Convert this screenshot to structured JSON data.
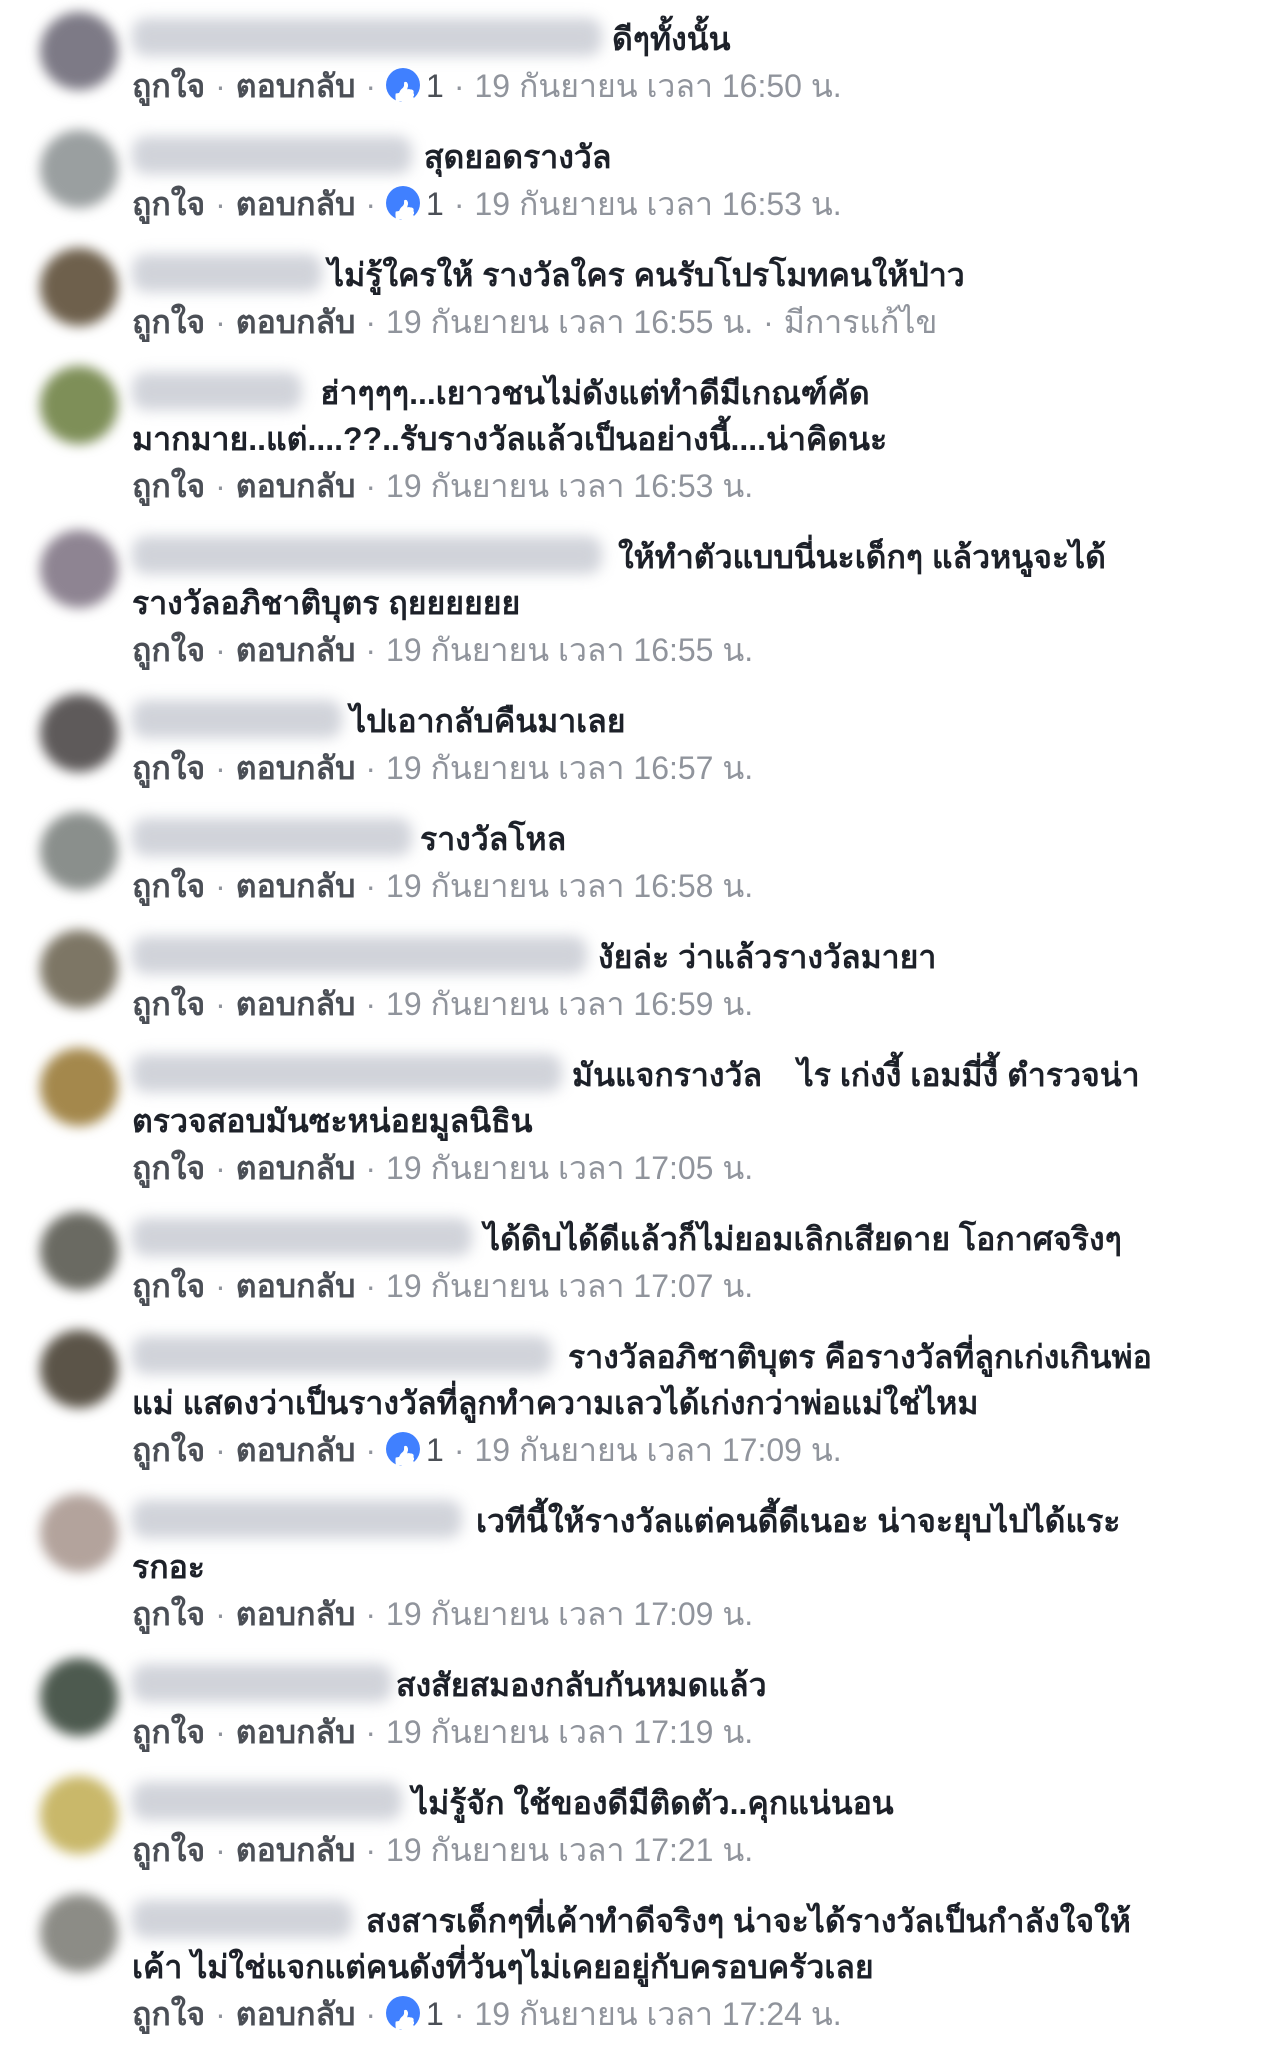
{
  "actions": {
    "like_label": "ถูกใจ",
    "reply_label": "ตอบกลับ",
    "separator": "·",
    "edited_label": "มีการแก้ไข"
  },
  "comments": [
    {
      "text": "ดีๆทั้งนั้น",
      "likes": "1",
      "time": "19 กันยายน เวลา 16:50 น."
    },
    {
      "text": "สุดยอดรางวัล",
      "likes": "1",
      "time": "19 กันยายน เวลา 16:53 น."
    },
    {
      "text": "ไม่รู้ใครให้ รางวัลใคร คนรับโปรโมทคนให้ป่าว",
      "time": "19 กันยายน เวลา 16:55 น."
    },
    {
      "text": "ฮ่าๆๆๆ...เยาวชนไม่ดังแต่ทำดีมีเกณฑ์คัด\nมากมาย..แต่....??..รับรางวัลแล้วเป็นอย่างนี้....น่าคิดนะ",
      "time": "19 กันยายน เวลา 16:53 น."
    },
    {
      "text": "ให้ทำตัวแบบนี่นะเด็กๆ แล้วหนูจะได้\nรางวัลอภิชาติบุตร ฤยยยยยย",
      "time": "19 กันยายน เวลา 16:55 น."
    },
    {
      "text": "ไปเอากลับคืนมาเลย",
      "time": "19 กันยายน เวลา 16:57 น."
    },
    {
      "text": "รางวัลโหล",
      "time": "19 กันยายน เวลา 16:58 น."
    },
    {
      "text": "งัยล่ะ ว่าแล้วรางวัลมายา",
      "time": "19 กันยายน เวลา 16:59 น."
    },
    {
      "text": "มันแจกรางวัล    ไร เก่งงี้ เอมมี่งี้ ตำรวจน่า\nตรวจสอบมันซะหน่อยมูลนิธิน",
      "time": "19 กันยายน เวลา 17:05 น."
    },
    {
      "text": "ได้ดิบได้ดีแล้วก็ไม่ยอมเลิกเสียดาย โอกาศจริงๆ",
      "time": "19 กันยายน เวลา 17:07 น."
    },
    {
      "text": "รางวัลอภิชาติบุตร คือรางวัลที่ลูกเก่งเกินพ่อ\nแม่ แสดงว่าเป็นรางวัลที่ลูกทำความเลวได้เก่งกว่าพ่อแม่ใช่ไหม",
      "likes": "1",
      "time": "19 กันยายน เวลา 17:09 น."
    },
    {
      "text": "เวทีนี้ให้รางวัลแต่คนดี้ดีเนอะ น่าจะยุบไปได้แระ\nรกอะ",
      "time": "19 กันยายน เวลา 17:09 น."
    },
    {
      "text": "สงสัยสมองกลับกันหมดแล้ว",
      "time": "19 กันยายน เวลา 17:19 น."
    },
    {
      "text": "ไม่รู้จัก ใช้ของดีมีติดตัว..คุกแน่นอน",
      "time": "19 กันยายน เวลา 17:21 น."
    },
    {
      "text": "สงสารเด็กๆที่เค้าทำดีจริงๆ น่าจะได้รางวัลเป็นกำลังใจให้\nเค้า ไม่ใช่แจกแต่คนดังที่วันๆไม่เคยอยู่กับครอบครัวเลย",
      "likes": "1",
      "time": "19 กันยายน เวลา 17:24 น."
    }
  ]
}
